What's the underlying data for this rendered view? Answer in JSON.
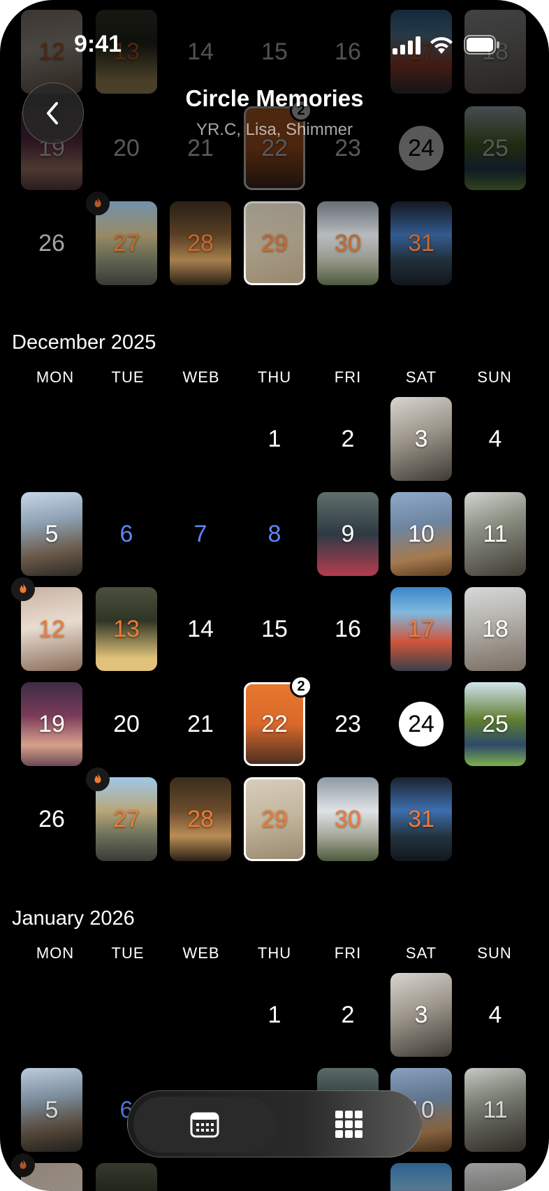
{
  "status_bar": {
    "time": "9:41"
  },
  "header": {
    "title": "Circle Memories",
    "subtitle": "YR.C, Lisa, Shimmer"
  },
  "weekdays": [
    "MON",
    "TUE",
    "WEB",
    "THU",
    "FRI",
    "SAT",
    "SUN"
  ],
  "months": [
    {
      "title": "December 2025"
    },
    {
      "title": "January 2026"
    }
  ],
  "calendar_days": {
    "d1": "1",
    "d2": "2",
    "d3": "3",
    "d4": "4",
    "d5": "5",
    "d6": "6",
    "d7": "7",
    "d8": "8",
    "d9": "9",
    "d10": "10",
    "d11": "11",
    "d12": "12",
    "d13": "13",
    "d14": "14",
    "d15": "15",
    "d16": "16",
    "d17": "17",
    "d18": "18",
    "d19": "19",
    "d20": "20",
    "d21": "21",
    "d22": "22",
    "d23": "23",
    "d24": "24",
    "d25": "25",
    "d26": "26",
    "d27": "27",
    "d28": "28",
    "d29": "29",
    "d30": "30",
    "d31": "31"
  },
  "badges": {
    "d22_count": "2"
  },
  "colors": {
    "orange_date": "#f07a34",
    "blue_date": "#5f86f5",
    "background": "#000000"
  },
  "icons": {
    "back": "chevron-left-icon",
    "calendar": "calendar-icon",
    "grid": "grid-icon",
    "streak": "fire-icon"
  }
}
